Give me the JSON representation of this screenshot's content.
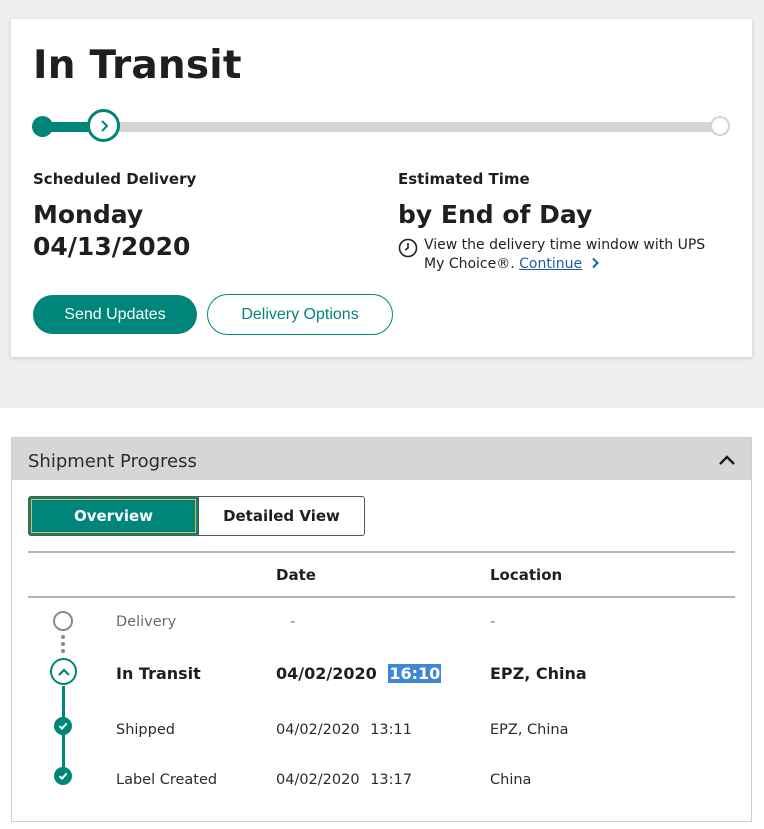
{
  "status": {
    "title": "In Transit",
    "progress_fraction": 0.09
  },
  "delivery": {
    "scheduled_label": "Scheduled Delivery",
    "scheduled_day": "Monday",
    "scheduled_date": "04/13/2020",
    "estimated_label": "Estimated Time",
    "estimated_value": "by End of Day",
    "note_text": "View the delivery time window with UPS My Choice®.",
    "continue_link": "Continue",
    "icon_clock": "clock-icon"
  },
  "actions": {
    "send_updates": "Send Updates",
    "delivery_options": "Delivery Options"
  },
  "shipment_progress": {
    "title": "Shipment Progress",
    "tabs": [
      {
        "label": "Overview",
        "active": true
      },
      {
        "label": "Detailed View",
        "active": false
      }
    ],
    "columns": {
      "date": "Date",
      "location": "Location"
    },
    "rows": [
      {
        "status": "Delivery",
        "date": "-",
        "time": "",
        "location": "-",
        "state": "pending"
      },
      {
        "status": "In Transit",
        "date": "04/02/2020",
        "time": "16:10",
        "location": "EPZ, China",
        "state": "current"
      },
      {
        "status": "Shipped",
        "date": "04/02/2020",
        "time": "13:11",
        "location": "EPZ, China",
        "state": "done"
      },
      {
        "status": "Label Created",
        "date": "04/02/2020",
        "time": "13:17",
        "location": "China",
        "state": "done"
      }
    ]
  },
  "colors": {
    "accent": "#00857a",
    "link": "#1b5ea8",
    "highlight": "#3f86d6",
    "track": "#d4d4d4"
  }
}
